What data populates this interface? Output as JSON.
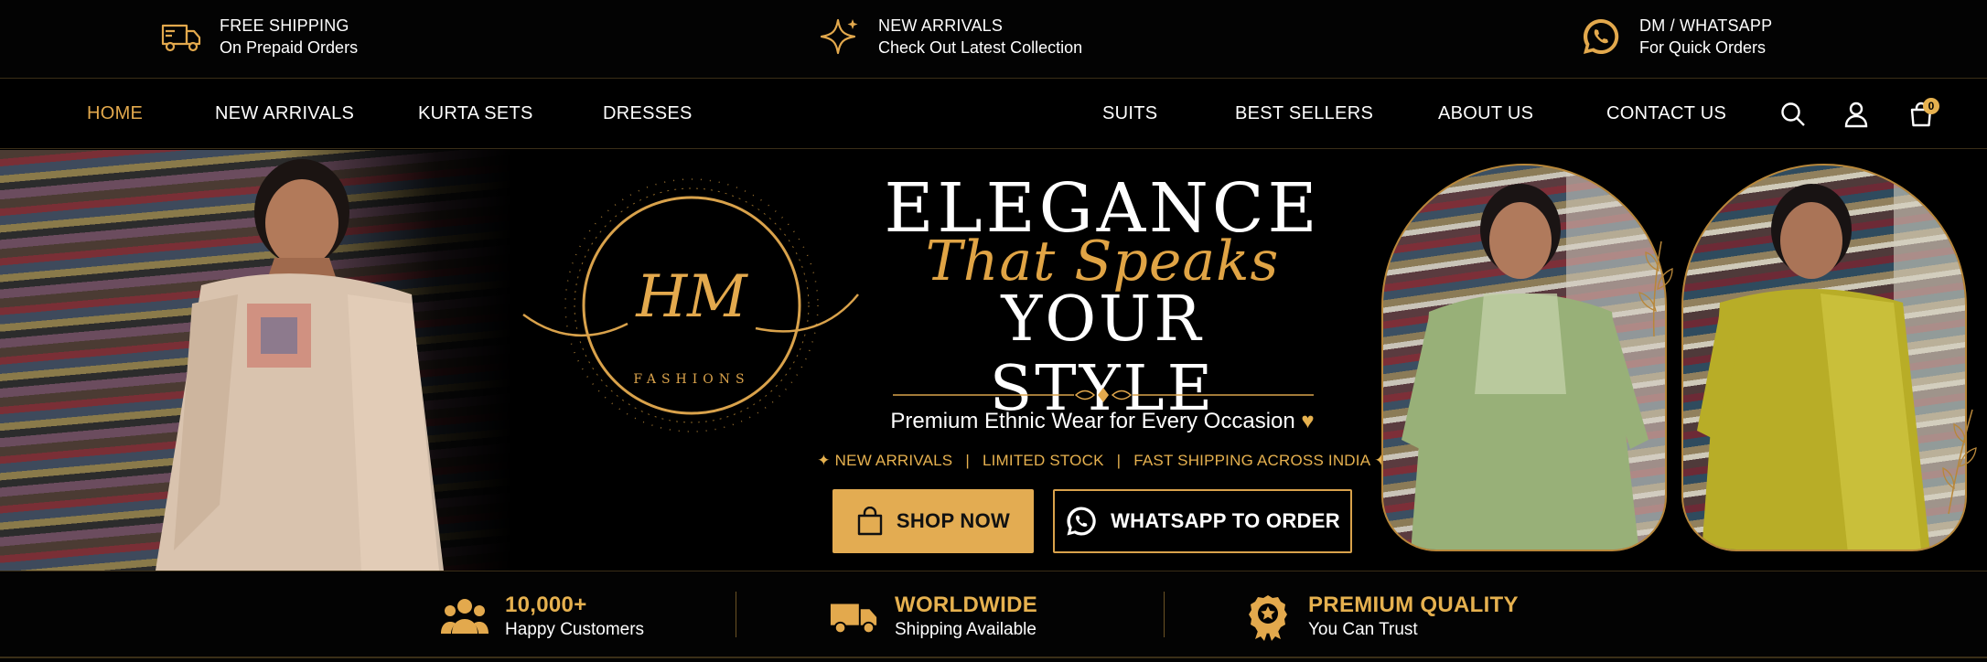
{
  "topbar": {
    "items": [
      {
        "icon": "truck-icon",
        "title": "FREE SHIPPING",
        "subtitle": "On Prepaid Orders"
      },
      {
        "icon": "sparkle-icon",
        "title": "NEW ARRIVALS",
        "subtitle": "Check Out Latest Collection"
      },
      {
        "icon": "whatsapp-icon",
        "title": "DM / WHATSAPP",
        "subtitle": "For Quick Orders"
      }
    ]
  },
  "nav": {
    "left": [
      "HOME",
      "NEW ARRIVALS",
      "KURTA SETS",
      "DRESSES"
    ],
    "right": [
      "SUITS",
      "BEST SELLERS",
      "ABOUT US",
      "CONTACT US"
    ],
    "active": "HOME",
    "cart_count": "0",
    "icons": [
      "search-icon",
      "user-icon",
      "cart-icon"
    ]
  },
  "hero": {
    "logo_monogram": "HM",
    "logo_word": "FASHIONS",
    "line1": "ELEGANCE",
    "line2": "That Speaks",
    "line3": "YOUR STYLE",
    "subtitle": "Premium Ethnic Wear for Every Occasion",
    "heart": "♥",
    "tags": [
      "NEW ARRIVALS",
      "LIMITED STOCK",
      "FAST SHIPPING ACROSS INDIA"
    ],
    "shop_button": "SHOP NOW",
    "whatsapp_button": "WHATSAPP TO ORDER"
  },
  "stats": [
    {
      "icon": "customers-icon",
      "value": "10,000+",
      "label": "Happy Customers"
    },
    {
      "icon": "delivery-truck-icon",
      "value": "WORLDWIDE",
      "label": "Shipping Available"
    },
    {
      "icon": "quality-badge-icon",
      "value": "PREMIUM QUALITY",
      "label": "You Can Trust"
    }
  ],
  "colors": {
    "accent": "#e3ac52",
    "background": "#000000"
  }
}
